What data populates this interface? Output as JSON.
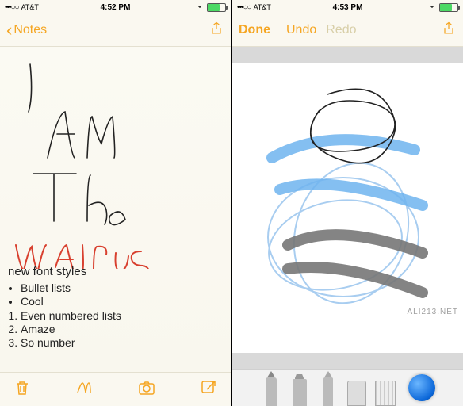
{
  "left": {
    "status": {
      "carrier": "AT&T",
      "signal": "•••○○",
      "time": "4:52 PM",
      "bluetooth": "✱"
    },
    "nav": {
      "back_label": "Notes"
    },
    "handwriting": {
      "line1": "I",
      "line2": "AM",
      "line3": "The",
      "line4_red": "Walrus"
    },
    "note": {
      "title": "new font styles",
      "bullets": [
        "Bullet lists",
        "Cool"
      ],
      "numbered": [
        "Even numbered lists",
        "Amaze",
        "So number"
      ]
    },
    "toolbar_icons": [
      "trash-icon",
      "sketch-icon",
      "camera-icon",
      "compose-icon"
    ]
  },
  "right": {
    "status": {
      "carrier": "AT&T",
      "signal": "•••○○",
      "time": "4:53 PM",
      "bluetooth": "✱"
    },
    "nav": {
      "done": "Done",
      "undo": "Undo",
      "redo": "Redo"
    },
    "tools": [
      "pen-tool",
      "marker-tool",
      "pencil-tool",
      "eraser-tool",
      "ruler-tool"
    ],
    "color": "#1776d6",
    "watermark": "ALI213.NET"
  }
}
